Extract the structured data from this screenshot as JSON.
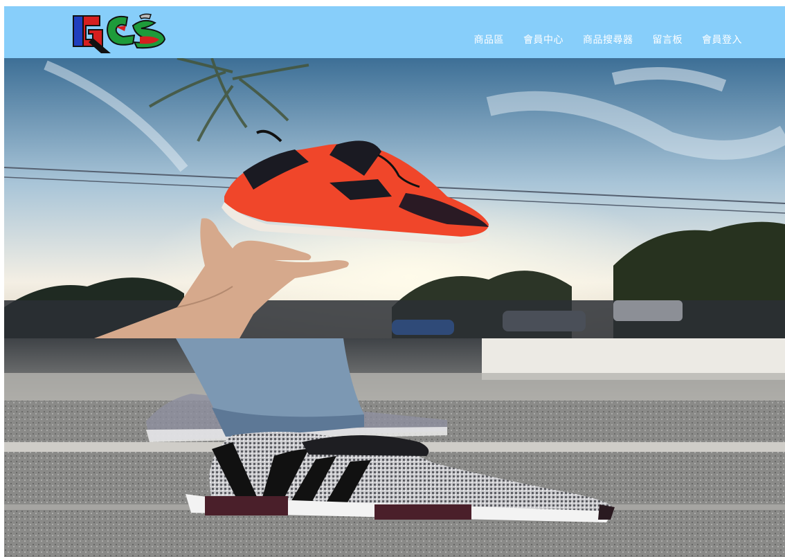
{
  "brand": {
    "logo_icon": "gcs-logo-icon",
    "colors": {
      "red": "#d61f1f",
      "green": "#1e9b3a",
      "blue": "#1f3fbf",
      "black": "#111111"
    }
  },
  "navbar": {
    "background": "#87cefa",
    "items": [
      {
        "label": "商品區"
      },
      {
        "label": "會員中心"
      },
      {
        "label": "商品搜尋器"
      },
      {
        "label": "留言板"
      },
      {
        "label": "會員登入"
      }
    ]
  }
}
